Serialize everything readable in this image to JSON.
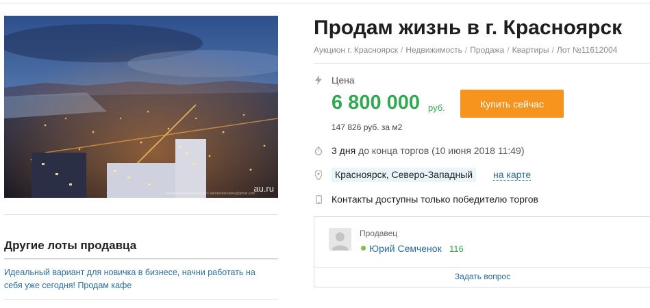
{
  "lot": {
    "title": "Продам жизнь в г. Красноярск",
    "breadcrumb": [
      "Аукцион г. Красноярск",
      "Недвижимость",
      "Продажа",
      "Квартиры",
      "Лот №11612004"
    ],
    "breadcrumb_separator": "/"
  },
  "photo": {
    "watermark": "au.ru",
    "credit": "sachaconv.livejournal.com © alexshcherbakov@gmail.com"
  },
  "price": {
    "label": "Цена",
    "value": "6 800 000",
    "currency": "руб.",
    "per_m2": "147 826 руб. за м2",
    "buy_button_label": "Купить сейчас"
  },
  "timing": {
    "days": "3 дня",
    "suffix": "до конца торгов",
    "end_date": "(10 июня 2018 11:49)"
  },
  "location": {
    "place": "Красноярск, Северо-Западный",
    "map_link": "на карте"
  },
  "contacts": {
    "text": "Контакты доступны только победителю торгов"
  },
  "seller": {
    "label": "Продавец",
    "name": "Юрий Семченок",
    "rating": "116",
    "ask_question": "Задать вопрос",
    "online": true
  },
  "other_lots": {
    "title": "Другие лоты продавца",
    "items": [
      "Идеальный вариант для новичка в бизнесе, начни работать на себя уже сегодня! Продам кафе"
    ]
  },
  "colors": {
    "price_green": "#33a852",
    "buy_button_orange": "#f7941d",
    "link_blue": "#2a6c9e",
    "location_tag_bg": "#eaf4fb",
    "online_dot": "#7bc043"
  },
  "icons": {
    "price": "lightning-icon",
    "time": "stopwatch-icon",
    "location": "map-pin-icon",
    "contacts": "phone-icon"
  }
}
